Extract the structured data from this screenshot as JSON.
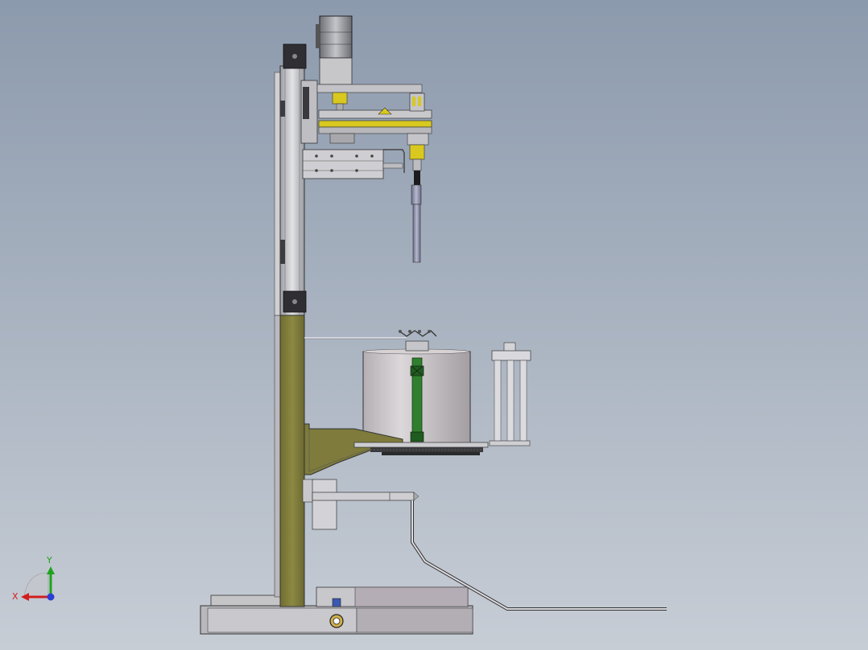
{
  "view": {
    "background_top": "#8c9aad",
    "background_bottom": "#c7cdd5"
  },
  "colors": {
    "olive": "#7f7c3a",
    "olive_light": "#a7a35a",
    "steel": "#c9c9cc",
    "steel_dark": "#8f9096",
    "green_shaft": "#2f7f2f",
    "yellow_accent": "#d8c81f",
    "drum": "#c8c3c6"
  },
  "triad": {
    "y_label": "Y",
    "x_label": "X",
    "y_color": "#1fa31f",
    "x_color": "#d21e1e",
    "z_color": "#2a3fd6"
  }
}
